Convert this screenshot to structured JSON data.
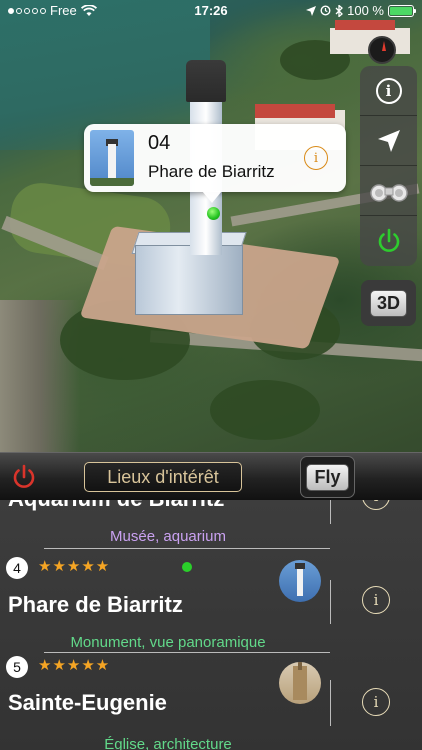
{
  "status_bar": {
    "carrier": "Free",
    "time": "17:26",
    "battery": "100 %",
    "battery_level": 1.0
  },
  "map": {
    "callout": {
      "number": "04",
      "name": "Phare de Biarritz"
    },
    "toolbar": {
      "buttons": [
        "info-icon",
        "location-arrow-icon",
        "binoculars-icon",
        "power-icon"
      ]
    },
    "btn_3d": "3D"
  },
  "panel": {
    "title": "Lieux d'intérêt",
    "fly": "Fly",
    "items": [
      {
        "title": "Aquarium de Biarritz",
        "category": "Musée, aquarium"
      },
      {
        "number": "4",
        "stars": "★★★★★",
        "title": "Phare de Biarritz",
        "category": "Monument, vue panoramique"
      },
      {
        "number": "5",
        "stars": "★★★★★",
        "title": "Sainte-Eugenie",
        "category": "Église, architecture"
      }
    ]
  },
  "colors": {
    "accent_orange": "#d98a17",
    "star": "#f5a524",
    "pin_green": "#22c21f",
    "power_red": "#d9342b",
    "category_green": "#62d98a",
    "category_purple": "#c9a1f0"
  }
}
